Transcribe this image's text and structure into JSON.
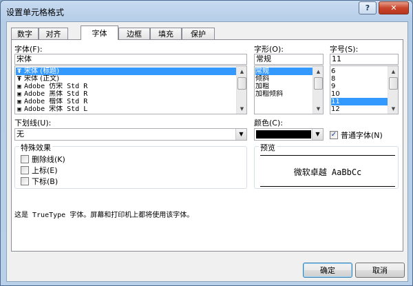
{
  "window": {
    "title": "设置单元格格式",
    "help_label": "?",
    "close_label": "✕"
  },
  "tabs": [
    {
      "label": "数字"
    },
    {
      "label": "对齐"
    },
    {
      "label": "字体"
    },
    {
      "label": "边框"
    },
    {
      "label": "填充"
    },
    {
      "label": "保护"
    }
  ],
  "active_tab": "字体",
  "font": {
    "label": "字体(F):",
    "value": "宋体",
    "items": [
      {
        "label": "宋体 (标题)",
        "icon": "truetype-icon",
        "selected": true
      },
      {
        "label": "宋体 (正文)",
        "icon": "truetype-icon",
        "selected": false
      },
      {
        "label": "Adobe 仿宋 Std R",
        "icon": "opentype-icon",
        "selected": false
      },
      {
        "label": "Adobe 黑体 Std R",
        "icon": "opentype-icon",
        "selected": false
      },
      {
        "label": "Adobe 楷体 Std R",
        "icon": "opentype-icon",
        "selected": false
      },
      {
        "label": "Adobe 宋体 Std L",
        "icon": "opentype-icon",
        "selected": false
      }
    ]
  },
  "style": {
    "label": "字形(O):",
    "value": "常规",
    "items": [
      {
        "label": "常规",
        "selected": true
      },
      {
        "label": "倾斜",
        "selected": false
      },
      {
        "label": "加粗",
        "selected": false
      },
      {
        "label": "加粗倾斜",
        "selected": false
      }
    ]
  },
  "size": {
    "label": "字号(S):",
    "value": "11",
    "items": [
      {
        "label": "6",
        "selected": false
      },
      {
        "label": "8",
        "selected": false
      },
      {
        "label": "9",
        "selected": false
      },
      {
        "label": "10",
        "selected": false
      },
      {
        "label": "11",
        "selected": true
      },
      {
        "label": "12",
        "selected": false
      }
    ]
  },
  "underline": {
    "label": "下划线(U):",
    "value": "无"
  },
  "color": {
    "label": "颜色(C):",
    "value": "#000000"
  },
  "normal_font": {
    "label": "普通字体(N)",
    "checked": true
  },
  "effects": {
    "title": "特殊效果",
    "items": [
      {
        "label": "删除线(K)",
        "checked": false
      },
      {
        "label": "上标(E)",
        "checked": false
      },
      {
        "label": "下标(B)",
        "checked": false
      }
    ]
  },
  "preview": {
    "title": "预览",
    "sample": "微软卓越  AaBbCc"
  },
  "description": "这是 TrueType 字体。屏幕和打印机上都将使用该字体。",
  "buttons": {
    "ok": "确定",
    "cancel": "取消"
  }
}
